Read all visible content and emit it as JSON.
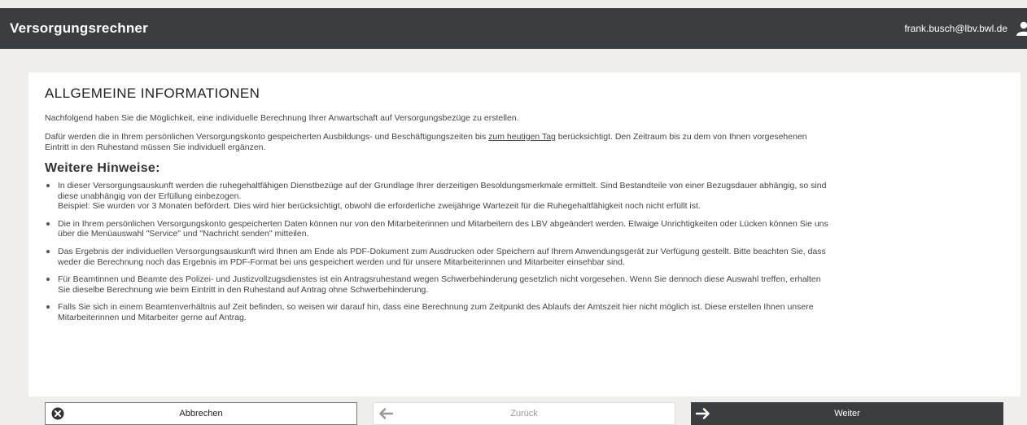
{
  "header": {
    "app_title": "Versorgungsrechner",
    "user_email": "frank.busch@lbv.bwl.de"
  },
  "main": {
    "title": "ALLGEMEINE INFORMATIONEN",
    "intro": "Nachfolgend haben Sie die Möglichkeit, eine individuelle Berechnung Ihrer Anwartschaft auf Versorgungsbezüge zu erstellen.",
    "para2_before": "Dafür werden die in Ihrem persönlichen Versorgungskonto gespeicherten Ausbildungs- und Beschäftigungszeiten bis ",
    "para2_link": "zum heutigen Tag",
    "para2_after": " berücksichtigt. Den Zeitraum bis zu dem von Ihnen vorgesehenen Eintritt in den Ruhestand müssen Sie individuell ergänzen.",
    "hints_title": "Weitere Hinweise:",
    "hints": [
      "In dieser Versorgungsauskunft werden die ruhegehaltfähigen Dienstbezüge auf der Grundlage Ihrer derzeitigen Besoldungsmerkmale ermittelt. Sind Bestandteile von einer Bezugsdauer abhängig, so sind diese unabhängig von der Erfüllung einbezogen.",
      "Beispiel: Sie wurden vor 3 Monaten befördert. Dies wird hier berücksichtigt, obwohl die erforderliche zweijährige Wartezeit für die Ruhegehaltfähigkeit noch nicht erfüllt ist.",
      "Die in Ihrem persönlichen Versorgungskonto gespeicherten Daten können nur von den Mitarbeiterinnen und Mitarbeitern des LBV abgeändert werden. Etwaige Unrichtigkeiten oder Lücken können Sie uns über die Menüauswahl \"Service\" und \"Nachricht senden\" mitteilen.",
      "Das Ergebnis der individuellen Versorgungsauskunft wird Ihnen am Ende als PDF-Dokument zum Ausdrucken oder Speichern auf Ihrem Anwendungsgerät zur Verfügung gestellt. Bitte beachten Sie, dass weder die Berechnung noch das Ergebnis im PDF-Format bei uns gespeichert werden und für unsere Mitarbeiterinnen und Mitarbeiter einsehbar sind.",
      "Für Beamtinnen und Beamte des Polizei- und Justizvollzugsdienstes ist ein Antragsruhestand wegen Schwerbehinderung gesetzlich nicht vorgesehen. Wenn Sie dennoch diese Auswahl treffen, erhalten Sie dieselbe Berechnung wie beim Eintritt in den Ruhestand auf Antrag ohne Schwerbehinderung.",
      "Falls Sie sich in einem Beamtenverhältnis auf Zeit befinden, so weisen wir darauf hin, dass eine Berechnung zum Zeitpunkt des Ablaufs der Amtszeit hier nicht möglich ist. Diese erstellen Ihnen unsere Mitarbeiterinnen und Mitarbeiter gerne auf Antrag."
    ]
  },
  "buttons": {
    "cancel": "Abbrechen",
    "back": "Zurück",
    "next": "Weiter"
  }
}
